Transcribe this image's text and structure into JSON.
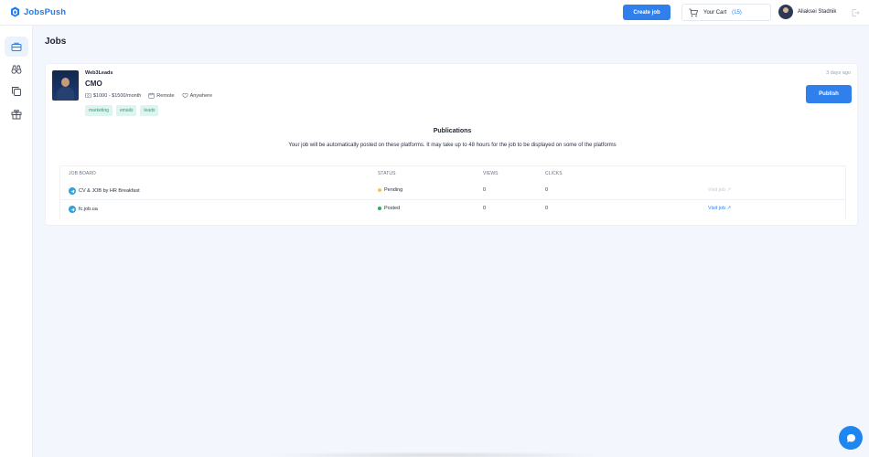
{
  "header": {
    "logo_text": "JobsPush",
    "create_button": "Create job",
    "cart_label": "Your Cart",
    "cart_count": "(15)",
    "user_name": "Aliaksei Stadnik"
  },
  "sidebar": {
    "items": [
      {
        "icon": "briefcase-icon",
        "active": true
      },
      {
        "icon": "binoculars-icon",
        "active": false
      },
      {
        "icon": "copy-icon",
        "active": false
      },
      {
        "icon": "gift-icon",
        "active": false
      }
    ]
  },
  "page": {
    "title": "Jobs"
  },
  "job": {
    "company": "Web3Leads",
    "title": "CMO",
    "salary": "$1000 - $1500/month",
    "work_type": "Remote",
    "location": "Anywhere",
    "tags": [
      "marketing",
      "emails",
      "leads"
    ],
    "posted_ago": "3 days ago",
    "publish_button": "Publish"
  },
  "publications": {
    "title": "Publications",
    "description": "Your job will be automatically posted on these platforms. It may take up to 48 hours for the job to be displayed on some of the platforms",
    "columns": [
      "JOB BOARD",
      "STATUS",
      "VIEWS",
      "CLICKS"
    ],
    "rows": [
      {
        "board": "CV & JOB by HR Breakfast",
        "status": "Pending",
        "status_color": "#f2c94c",
        "views": "0",
        "clicks": "0",
        "link": "Visit job ↗",
        "link_enabled": false
      },
      {
        "board": "fc.job.ua",
        "status": "Posted",
        "status_color": "#27ae60",
        "views": "0",
        "clicks": "0",
        "link": "Visit job ↗",
        "link_enabled": true
      }
    ]
  },
  "colors": {
    "accent": "#2f80ed",
    "tag_text": "#2d9c7c",
    "tag_bg": "#def4ee"
  }
}
